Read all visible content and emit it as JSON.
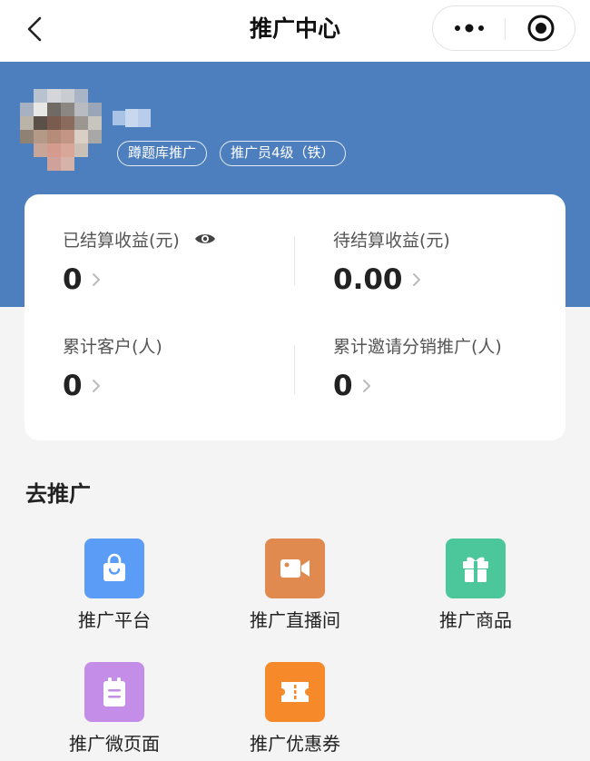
{
  "nav": {
    "title": "推广中心"
  },
  "profile": {
    "tags": [
      "蹲题库推广",
      "推广员4级（铁）"
    ]
  },
  "stats": [
    {
      "label": "已结算收益(元)",
      "value": "0",
      "has_eye": true
    },
    {
      "label": "待结算收益(元)",
      "value": "0.00",
      "has_eye": false
    },
    {
      "label": "累计客户(人)",
      "value": "0",
      "has_eye": false
    },
    {
      "label": "累计邀请分销推广(人)",
      "value": "0",
      "has_eye": false
    }
  ],
  "promote": {
    "title": "去推广",
    "items": [
      {
        "label": "推广平台",
        "icon": "shopping-bag-icon",
        "color": "#5b9cf6"
      },
      {
        "label": "推广直播间",
        "icon": "video-camera-icon",
        "color": "#e08a4f"
      },
      {
        "label": "推广商品",
        "icon": "gift-icon",
        "color": "#4cc79b"
      },
      {
        "label": "推广微页面",
        "icon": "clipboard-icon",
        "color": "#c38de8"
      },
      {
        "label": "推广优惠券",
        "icon": "coupon-icon",
        "color": "#f6892a"
      }
    ]
  },
  "colors": {
    "header_blue": "#4d7fbf",
    "page_bg": "#f4f4f4"
  }
}
